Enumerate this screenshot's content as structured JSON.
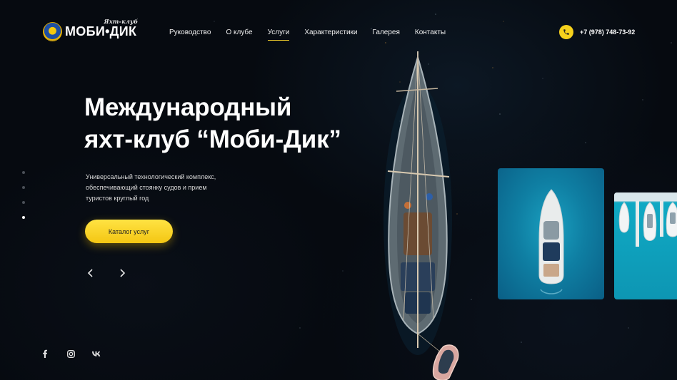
{
  "header": {
    "logo": {
      "name": "МОБИ•ДИК",
      "tagline": "Яхт-клуб"
    },
    "nav": [
      {
        "label": "Руководство",
        "active": false
      },
      {
        "label": "О клубе",
        "active": false
      },
      {
        "label": "Услуги",
        "active": true
      },
      {
        "label": "Характеристики",
        "active": false
      },
      {
        "label": "Галерея",
        "active": false
      },
      {
        "label": "Контакты",
        "active": false
      }
    ],
    "phone": {
      "icon": "phone-icon",
      "number": "+7 (978) 748-73-92"
    }
  },
  "hero": {
    "title_line1": "Международный",
    "title_line2": "яхт-клуб “Моби-Дик”",
    "subtitle_line1": "Универсальный технологический комплекс,",
    "subtitle_line2": "обеспечивающий стоянку судов и прием",
    "subtitle_line3": "туристов круглый год",
    "cta_label": "Каталог услуг",
    "prev_icon": "chevron-left-icon",
    "next_icon": "chevron-right-icon"
  },
  "slider": {
    "total": 4,
    "active_index": 3
  },
  "social": [
    "facebook-icon",
    "instagram-icon",
    "vk-icon"
  ],
  "colors": {
    "accent": "#f6d11c",
    "background": "#060a10",
    "text": "#ffffff"
  }
}
